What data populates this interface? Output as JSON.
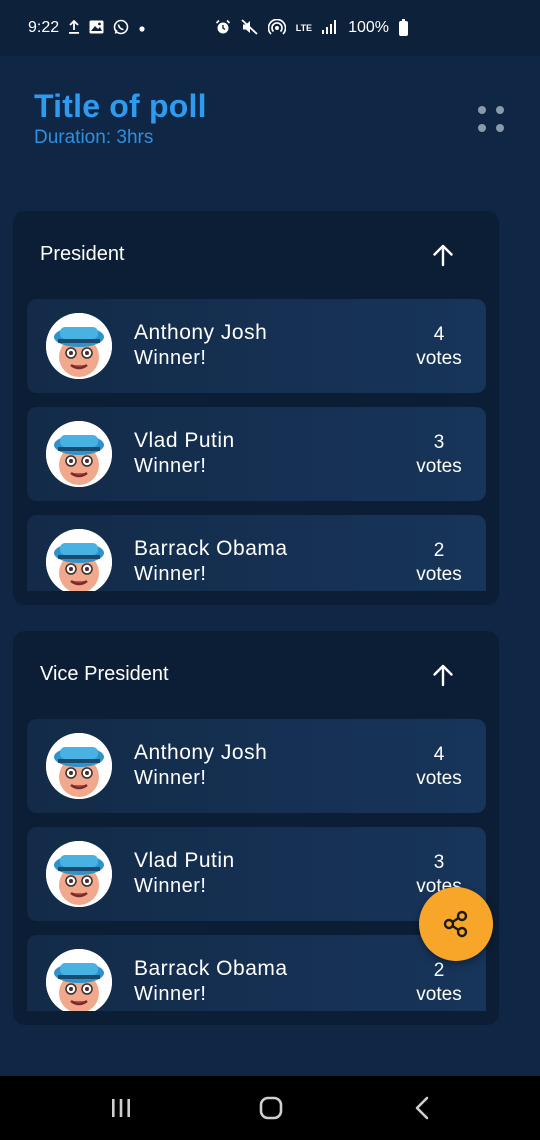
{
  "status_bar": {
    "time": "9:22",
    "left_icons": [
      "upload-icon",
      "image-icon",
      "whatsapp-icon",
      "dot-icon"
    ],
    "right_icons": [
      "alarm-icon",
      "mute-icon",
      "hotspot-icon",
      "lte-icon",
      "signal-icon"
    ],
    "lte_text": "LTE",
    "battery_text": "100%"
  },
  "header": {
    "title": "Title of poll",
    "duration": "Duration: 3hrs",
    "menu_icon": "more-dots-icon"
  },
  "sections": [
    {
      "title": "President",
      "toggle_icon": "arrow-up-icon",
      "candidates": [
        {
          "name": "Anthony Josh",
          "status": "Winner!",
          "votes": "4",
          "votes_label": "votes"
        },
        {
          "name": "Vlad Putin",
          "status": "Winner!",
          "votes": "3",
          "votes_label": "votes"
        },
        {
          "name": "Barrack Obama",
          "status": "Winner!",
          "votes": "2",
          "votes_label": "votes"
        }
      ]
    },
    {
      "title": "Vice President",
      "toggle_icon": "arrow-up-icon",
      "candidates": [
        {
          "name": "Anthony Josh",
          "status": "Winner!",
          "votes": "4",
          "votes_label": "votes"
        },
        {
          "name": "Vlad Putin",
          "status": "Winner!",
          "votes": "3",
          "votes_label": "votes"
        },
        {
          "name": "Barrack Obama",
          "status": "Winner!",
          "votes": "2",
          "votes_label": "votes"
        }
      ]
    }
  ],
  "fab": {
    "icon": "share-icon"
  },
  "nav_bar": {
    "icons": [
      "recents-icon",
      "home-icon",
      "back-icon"
    ]
  },
  "colors": {
    "background": "#0f2744",
    "card": "#0c1e35",
    "candidate_row": "#17345a",
    "title_blue": "#2f9bf0",
    "fab_orange": "#f8a62a"
  }
}
